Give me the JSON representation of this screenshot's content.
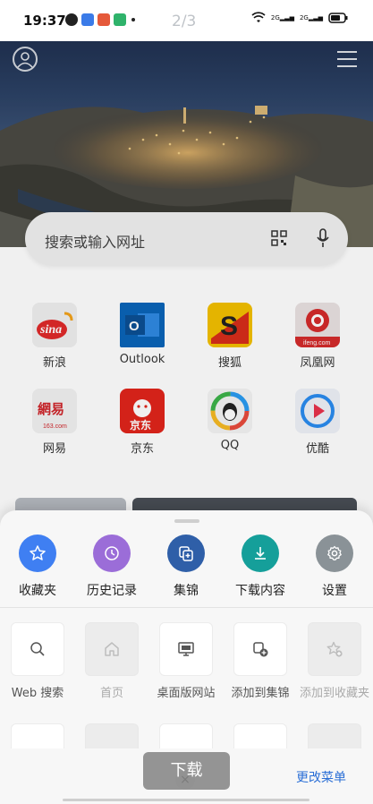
{
  "status_bar": {
    "time": "19:37",
    "page_indicator": "2/3",
    "network_1": "2G",
    "network_2": "2G"
  },
  "search": {
    "placeholder": "搜索或输入网址"
  },
  "quick_links": [
    {
      "label": "新浪",
      "logo_text": "sina",
      "color": "#e02a2a"
    },
    {
      "label": "Outlook",
      "logo_text": "O",
      "color": "#0a64b8"
    },
    {
      "label": "搜狐",
      "logo_text": "S",
      "color": "#f3c000"
    },
    {
      "label": "凤凰网",
      "logo_text": "ifeng.com",
      "color": "#d42b2b"
    },
    {
      "label": "网易",
      "logo_text": "網易",
      "color": "#d0262b"
    },
    {
      "label": "京东",
      "logo_text": "京东",
      "color": "#e1251b"
    },
    {
      "label": "QQ",
      "logo_text": "QQ",
      "color": "#2a9cf2"
    },
    {
      "label": "优酷",
      "logo_text": "▶",
      "color": "#2a8cf0"
    }
  ],
  "sheet": {
    "top_actions": [
      {
        "label": "收藏夹",
        "icon": "star-icon",
        "color": "#3f7ff2"
      },
      {
        "label": "历史记录",
        "icon": "history-icon",
        "color": "#9b6dd8"
      },
      {
        "label": "集锦",
        "icon": "collection-icon",
        "color": "#2f5fa8"
      },
      {
        "label": "下载内容",
        "icon": "download-icon",
        "color": "#159f9a"
      },
      {
        "label": "设置",
        "icon": "gear-icon",
        "color": "#8a9297"
      }
    ],
    "grid_items": [
      {
        "label": "Web 搜索",
        "icon": "search-icon",
        "disabled": false
      },
      {
        "label": "首页",
        "icon": "home-icon",
        "disabled": true
      },
      {
        "label": "桌面版网站",
        "icon": "desktop-icon",
        "disabled": false
      },
      {
        "label": "添加到集锦",
        "icon": "add-collection-icon",
        "disabled": false
      },
      {
        "label": "添加到收藏夹",
        "icon": "add-favorite-icon",
        "disabled": true
      }
    ],
    "edit_menu_label": "更改菜单",
    "close_glyph": "×"
  },
  "toast": {
    "text": "下载"
  }
}
